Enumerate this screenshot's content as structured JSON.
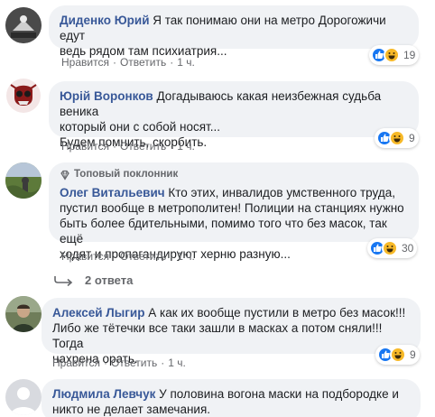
{
  "comments": [
    {
      "author": "Диденко Юрий",
      "text_lines": [
        "Я так понимаю они на метро Дорогожичи едут",
        "ведь рядом там психиатрия..."
      ],
      "like_label": "Нравится",
      "reply_label": "Ответить",
      "time": "1 ч.",
      "reaction_count": "19"
    },
    {
      "author": "Юрій Воронков",
      "text_lines": [
        "Догадываюсь какая неизбежная судьба веника",
        "который они с собой носят...",
        "Будем помнить, скорбить."
      ],
      "like_label": "Нравится",
      "reply_label": "Ответить",
      "time": "1 ч.",
      "reaction_count": "9"
    },
    {
      "badge": "Топовый поклонник",
      "author": "Олег Витальевич",
      "text_lines": [
        "Кто этих, инвалидов умственного труда,",
        "пустил вообще в метрополитен! Полиции на станциях нужно",
        "быть более бдительными, помимо того что без масок, так ещё",
        "ходят и пропагандируют херню разную..."
      ],
      "like_label": "Нравится",
      "reply_label": "Ответить",
      "time": "1 ч.",
      "reaction_count": "30",
      "replies_label": "2 ответа"
    },
    {
      "author": "Алексей Лыгир",
      "text_lines": [
        "А как их вообще пустили в метро без масок!!!",
        "Либо же тётечки все таки зашли в масках а потом сняли!!! Тогда",
        "нахрена орать."
      ],
      "like_label": "Нравится",
      "reply_label": "Ответить",
      "time": "1 ч.",
      "reaction_count": "9"
    },
    {
      "author": "Людмила Левчук",
      "text_lines": [
        "У половина вогона маски на подбородке и",
        "никто не делает замечания."
      ]
    }
  ],
  "separator": "·",
  "icons": {
    "like": "like-icon",
    "haha": "haha-icon",
    "badge": "diamond-badge-icon",
    "reply_arrow": "reply-arrow-icon"
  },
  "colors": {
    "author": "#385898",
    "bubble": "#f0f2f5",
    "like_blue": "#1877f2",
    "haha_yellow": "#f7b928"
  }
}
